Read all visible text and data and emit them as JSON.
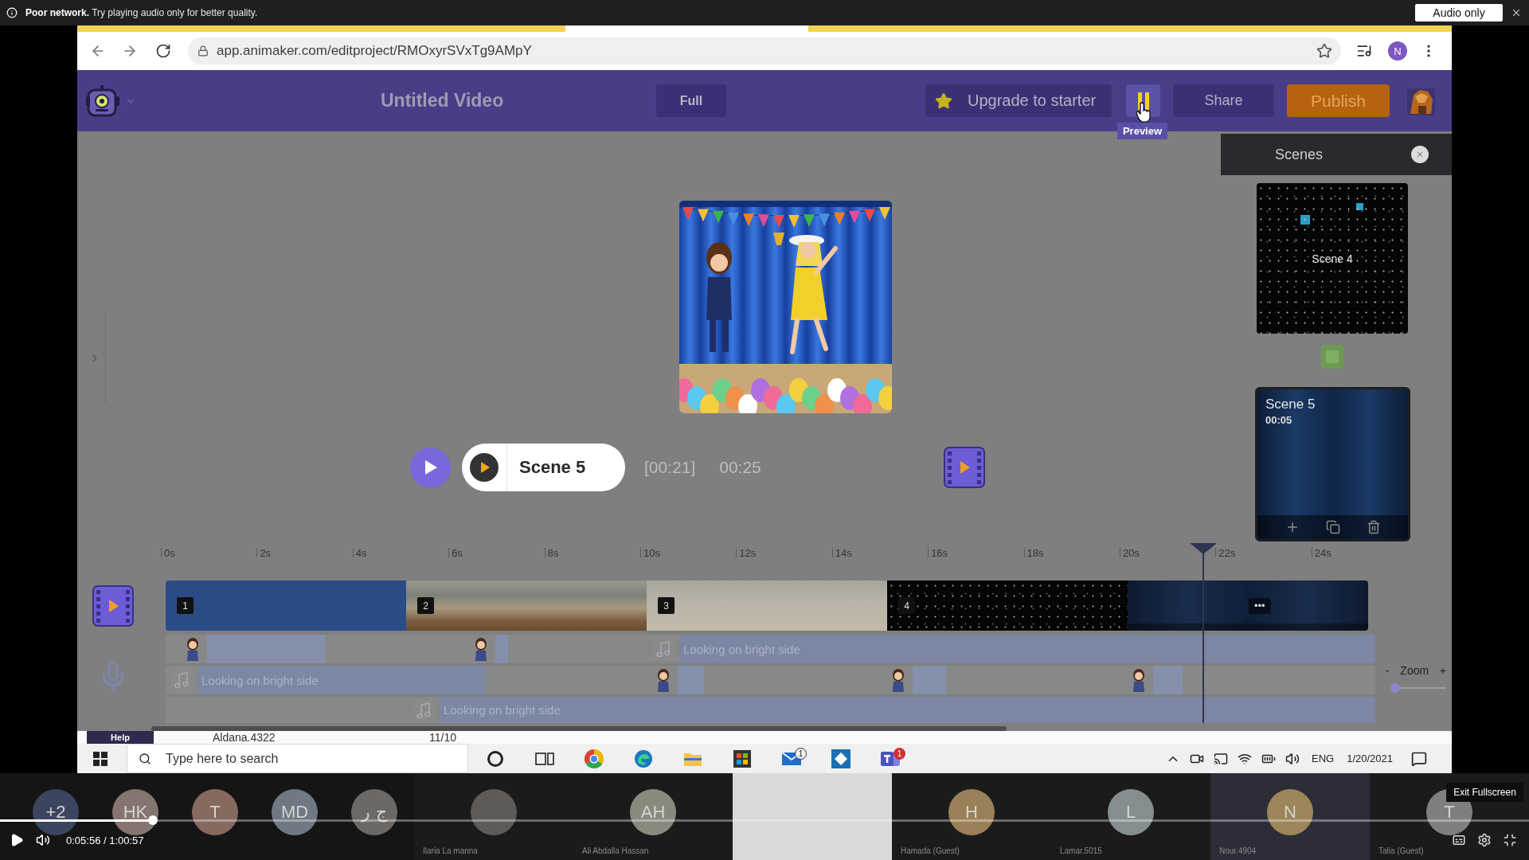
{
  "notice": {
    "message": "**Poor network.** Try playing audio only for better quality.",
    "button": "Audio only"
  },
  "browser": {
    "url": "app.animaker.com/editproject/RMOxyrSVxTg9AMpY",
    "profile_initial": "N"
  },
  "app_header": {
    "title": "Untitled Video",
    "view_button": "Full",
    "upgrade_button": "Upgrade to starter",
    "preview_tooltip": "Preview",
    "share_button": "Share",
    "publish_button": "Publish"
  },
  "scenes_panel": {
    "title": "Scenes",
    "scenes": [
      {
        "kind": "thumbnail",
        "title": "Scene 4",
        "selected": false
      },
      {
        "kind": "card",
        "title": "Scene 5",
        "duration": "00:05",
        "selected": true
      }
    ]
  },
  "player": {
    "scene": "Scene 5",
    "current_time": "[00:21]",
    "total_time": "00:25"
  },
  "timeline": {
    "ticks": [
      "0s",
      "2s",
      "4s",
      "6s",
      "8s",
      "10s",
      "12s",
      "14s",
      "16s",
      "18s",
      "20s",
      "22s",
      "24s"
    ],
    "playhead": {
      "level": 0.906
    },
    "clips": [
      {
        "kind": "solid",
        "number": "1"
      },
      {
        "kind": "waves",
        "number": "2"
      },
      {
        "kind": "sand",
        "number": "3"
      },
      {
        "kind": "stars",
        "number": "4"
      },
      {
        "kind": "night",
        "menu": "•••"
      }
    ],
    "tracks": [
      {
        "items": [
          {
            "kind": "character"
          },
          {
            "kind": "character"
          },
          {
            "kind": "audio",
            "label": "Looking on bright side"
          }
        ]
      },
      {
        "items": [
          {
            "kind": "audio",
            "label": "Looking on bright side"
          },
          {
            "kind": "character"
          },
          {
            "kind": "character"
          },
          {
            "kind": "character"
          }
        ]
      },
      {
        "items": [
          {
            "kind": "audio",
            "label": "Looking on bright side"
          }
        ]
      }
    ],
    "zoom": {
      "minus": "-",
      "label": "Zoom",
      "plus": "+",
      "level": 0
    }
  },
  "info_strip": {
    "help": "Help",
    "user": "Aldana.4322",
    "count": "11/10"
  },
  "taskbar": {
    "search_placeholder": "Type here to search",
    "apps": [
      {
        "kind": "cortana"
      },
      {
        "kind": "task-view"
      },
      {
        "kind": "chrome"
      },
      {
        "kind": "edge"
      },
      {
        "kind": "explorer"
      },
      {
        "kind": "store"
      },
      {
        "kind": "mail",
        "badge": {
          "kind": "outline",
          "text": "1"
        }
      },
      {
        "kind": "app"
      },
      {
        "kind": "teams",
        "badge": {
          "kind": "alert",
          "text": "1"
        }
      }
    ],
    "tray": [
      {
        "kind": "chevron"
      },
      {
        "kind": "camera"
      },
      {
        "kind": "cast"
      },
      {
        "kind": "wifi"
      },
      {
        "kind": "battery"
      },
      {
        "kind": "volume"
      }
    ],
    "language": "ENG",
    "date": "1/20/2021"
  },
  "participants": {
    "others": [
      {
        "initials": "+2",
        "color": "#3b4560"
      },
      {
        "initials": "HK",
        "color": "#857571"
      },
      {
        "initials": "T",
        "color": "#86695f"
      },
      {
        "initials": "MD",
        "color": "#6f7883"
      },
      {
        "initials": "ج ر",
        "color": "#6c6866"
      }
    ],
    "tiles": [
      {
        "kind": "photo",
        "name": "Ilaria La manna",
        "highlighted": false
      },
      {
        "kind": "initials",
        "initials": "AH",
        "name": "Ali Abdalla Hassan",
        "color": "#868b7e",
        "highlighted": false
      },
      {
        "kind": "video",
        "highlighted": false
      },
      {
        "kind": "initials",
        "initials": "H",
        "name": "Hamada (Guest)",
        "color": "#9a8058",
        "highlighted": false
      },
      {
        "kind": "initials",
        "initials": "L",
        "name": "Lamar.5015",
        "color": "#868d8e",
        "highlighted": false
      },
      {
        "kind": "initials",
        "initials": "N",
        "name": "Nour.4904",
        "color": "#9c8558",
        "highlighted": true
      },
      {
        "kind": "initials",
        "initials": "T",
        "name": "Talia (Guest)",
        "color": "#7f7f7f",
        "highlighted": false
      }
    ]
  },
  "video_controls": {
    "progress": {
      "level": 0.1
    },
    "time": "0:05:56 / 1:00:57",
    "tooltip": "Exit Fullscreen"
  }
}
